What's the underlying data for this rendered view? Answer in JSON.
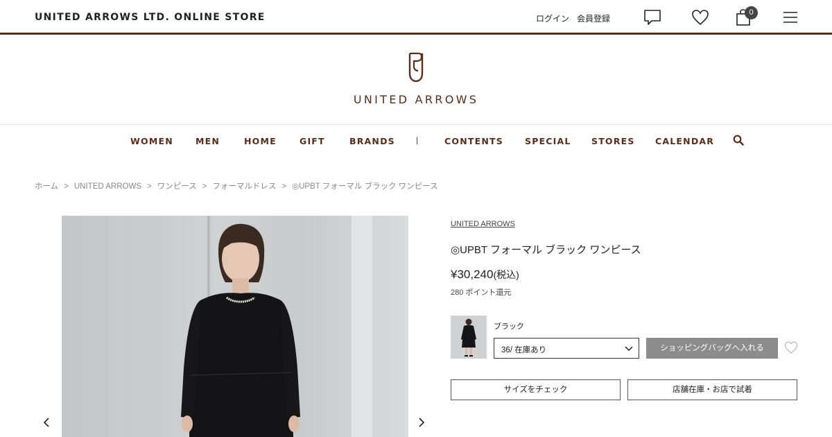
{
  "header": {
    "store_title": "UNITED ARROWS LTD. ONLINE STORE",
    "login": "ログイン",
    "register": "会員登録",
    "bag_count": "0"
  },
  "logo": {
    "text": "UNITED ARROWS"
  },
  "nav": {
    "items": [
      "WOMEN",
      "MEN",
      "HOME",
      "GIFT",
      "BRANDS",
      "CONTENTS",
      "SPECIAL",
      "STORES",
      "CALENDAR"
    ],
    "separator": "|"
  },
  "breadcrumb": {
    "items": [
      "ホーム",
      "UNITED ARROWS",
      "ワンピース",
      "フォーマルドレス",
      "◎UPBT フォーマル ブラック ワンピース"
    ],
    "separator": ">"
  },
  "product": {
    "brand": "UNITED ARROWS",
    "title": "◎UPBT フォーマル ブラック ワンピース",
    "price": "¥30,240",
    "price_tax": "(税込)",
    "points": "280 ポイント還元",
    "color_name": "ブラック",
    "size_selected": "36/ 在庫あり",
    "add_to_bag": "ショッピングバッグへ入れる",
    "size_check": "サイズをチェック",
    "store_stock": "店舗在庫・お店で試着"
  },
  "gallery": {
    "prev": "‹",
    "next": "›"
  },
  "colors": {
    "brand_brown": "#5a2d1a",
    "button_gray": "#8c8c8c"
  }
}
